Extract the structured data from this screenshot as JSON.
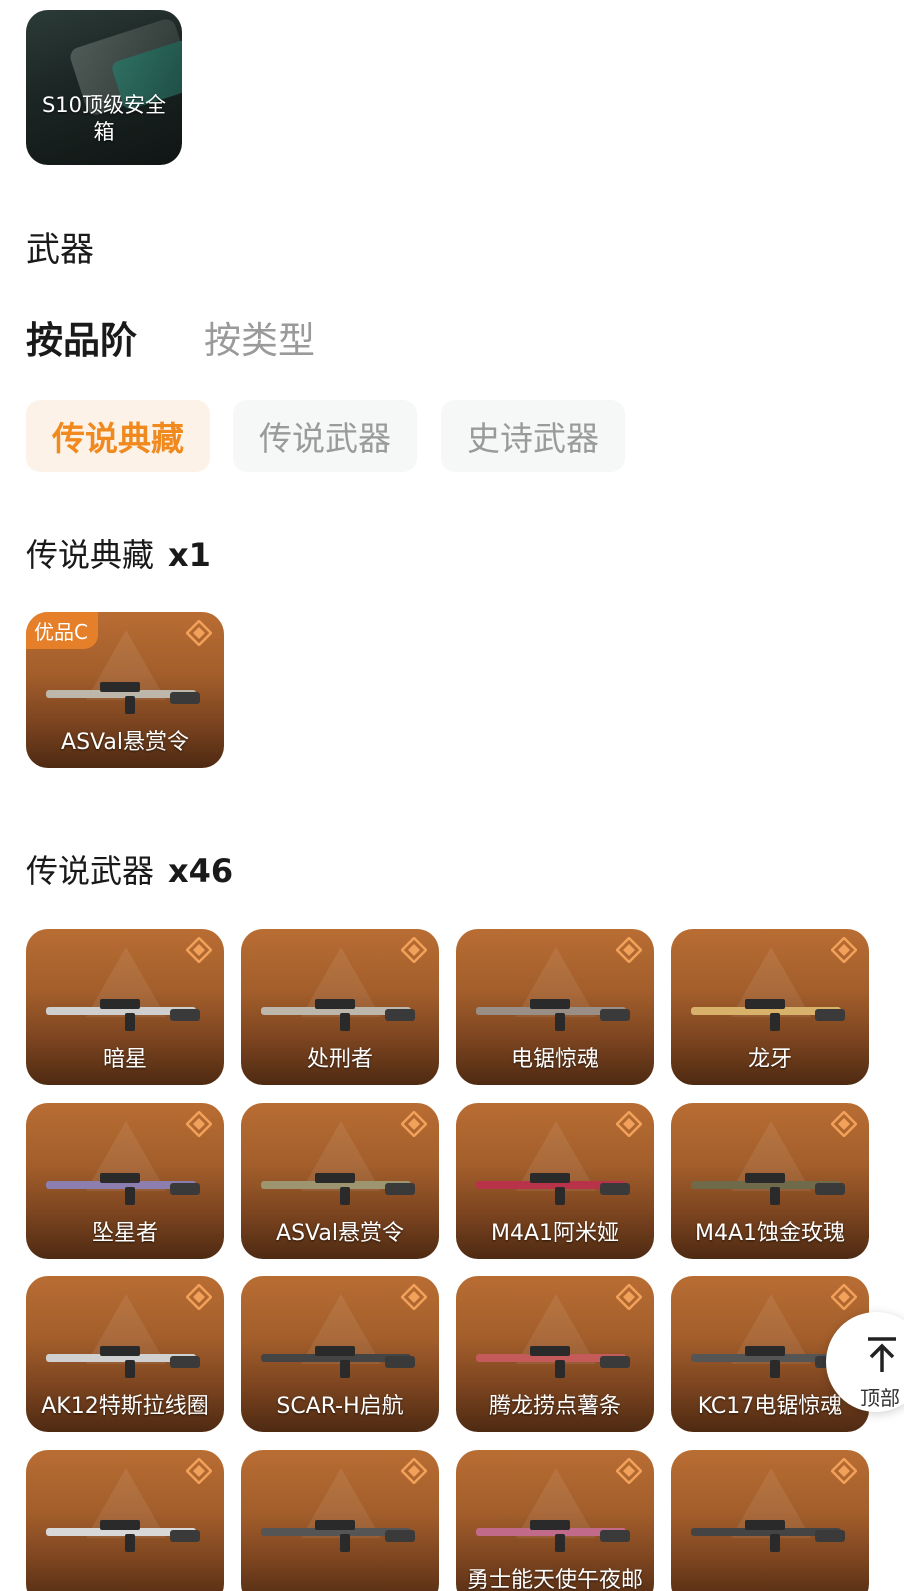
{
  "safe_box": {
    "label": "S10顶级安全箱"
  },
  "section": {
    "title": "武器"
  },
  "primary_tabs": [
    {
      "label": "按品阶",
      "active": true
    },
    {
      "label": "按类型",
      "active": false
    }
  ],
  "grade_chips": [
    {
      "label": "传说典藏",
      "active": true
    },
    {
      "label": "传说武器",
      "active": false
    },
    {
      "label": "史诗武器",
      "active": false
    }
  ],
  "groups": [
    {
      "title": "传说典藏",
      "count": "x1",
      "items": [
        {
          "name": "ASVal悬赏令",
          "badge": "优品C"
        }
      ]
    },
    {
      "title": "传说武器",
      "count": "x46",
      "items": [
        {
          "name": "暗星"
        },
        {
          "name": "处刑者"
        },
        {
          "name": "电锯惊魂"
        },
        {
          "name": "龙牙"
        },
        {
          "name": "坠星者"
        },
        {
          "name": "ASVal悬赏令"
        },
        {
          "name": "M4A1阿米娅"
        },
        {
          "name": "M4A1蚀金玫瑰"
        },
        {
          "name": "AK12特斯拉线圈"
        },
        {
          "name": "SCAR-H启航"
        },
        {
          "name": "腾龙捞点薯条"
        },
        {
          "name": "KC17电锯惊魂"
        },
        {
          "name": ""
        },
        {
          "name": ""
        },
        {
          "name": "勇士能天使午夜邮"
        },
        {
          "name": ""
        }
      ]
    }
  ],
  "back_to_top": {
    "label": "顶部"
  },
  "colors": {
    "accent": "#f08a1e",
    "card_top": "#b86d33",
    "card_bottom": "#4e2a12"
  }
}
